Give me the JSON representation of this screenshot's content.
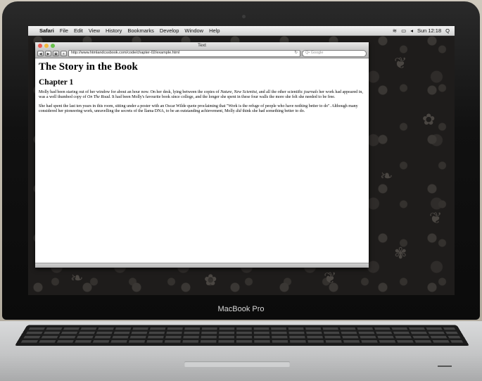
{
  "menubar": {
    "apple": "",
    "app": "Safari",
    "items": [
      "File",
      "Edit",
      "View",
      "History",
      "Bookmarks",
      "Develop",
      "Window",
      "Help"
    ],
    "clock": "Sun 12:18",
    "search_glyph": "Q"
  },
  "window": {
    "title": "Text",
    "url": "http://www.htmlandcssbook.com/code/chapter-02/example.html",
    "search_placeholder": "Q• Google"
  },
  "page": {
    "heading": "The Story in the Book",
    "subheading": "Chapter 1",
    "p1_a": "Molly had been staring out of her window for about an hour now. On her desk, lying between the copies of ",
    "p1_nature": "Nature",
    "p1_b": ", ",
    "p1_newsci": "New Scientist",
    "p1_c": ", and all the other scientific ",
    "p1_journals": "journals",
    "p1_d": " her work had appeared in, was a well thumbed copy of ",
    "p1_road": "On The Road",
    "p1_e": ". It had been Molly's favourite book since college, and the longer she spent in these four walls the more she felt she needed to be free.",
    "p2_a": "She had spent the last ten years in this room, sitting under a poster with an Oscar Wilde quote proclaiming that \"Work is the refuge of people who have nothing better to do\". Although many considered her pioneering work, unravelling the secrets of the llama DNA, to be an outstanding achievement, Molly ",
    "p2_did": "did",
    "p2_b": " think she had something better to do."
  },
  "laptop": {
    "model": "MacBook Pro"
  },
  "colors": {
    "light_close": "#ee5a52",
    "light_min": "#f3b93c",
    "light_zoom": "#67c14a"
  }
}
